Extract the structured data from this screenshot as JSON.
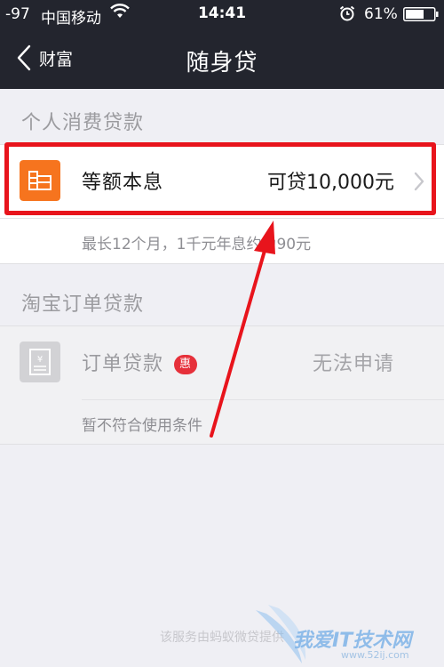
{
  "status_bar": {
    "signal": "-97",
    "carrier": "中国移动",
    "time": "14:41",
    "battery": "61%"
  },
  "nav": {
    "back_label": "财富",
    "title": "随身贷"
  },
  "personal_section": {
    "header": "个人消费贷款",
    "item": {
      "title": "等额本息",
      "amount": "可贷10,000元",
      "note": "最长12个月，1千元年息约为90元"
    }
  },
  "taobao_section": {
    "header": "淘宝订单贷款",
    "item": {
      "title": "订单贷款",
      "badge": "惠",
      "status": "无法申请",
      "note": "暂不符合使用条件"
    }
  },
  "footer": {
    "text": "该服务由蚂蚁微贷提供"
  },
  "watermark": {
    "text": "我爱IT技术网",
    "url": "www.52ij.com"
  },
  "colors": {
    "header_bg": "#23252e",
    "page_bg": "#efeff4",
    "accent_orange": "#f6741e",
    "highlight_red": "#e8141c",
    "badge_red": "#e6303a"
  },
  "icons": {
    "back": "chevron-left-icon",
    "row_chevron": "chevron-right-icon",
    "installment": "installment-card-icon",
    "order_receipt": "receipt-yen-icon",
    "wifi": "wifi-icon",
    "alarm": "alarm-clock-icon",
    "battery": "battery-icon"
  }
}
